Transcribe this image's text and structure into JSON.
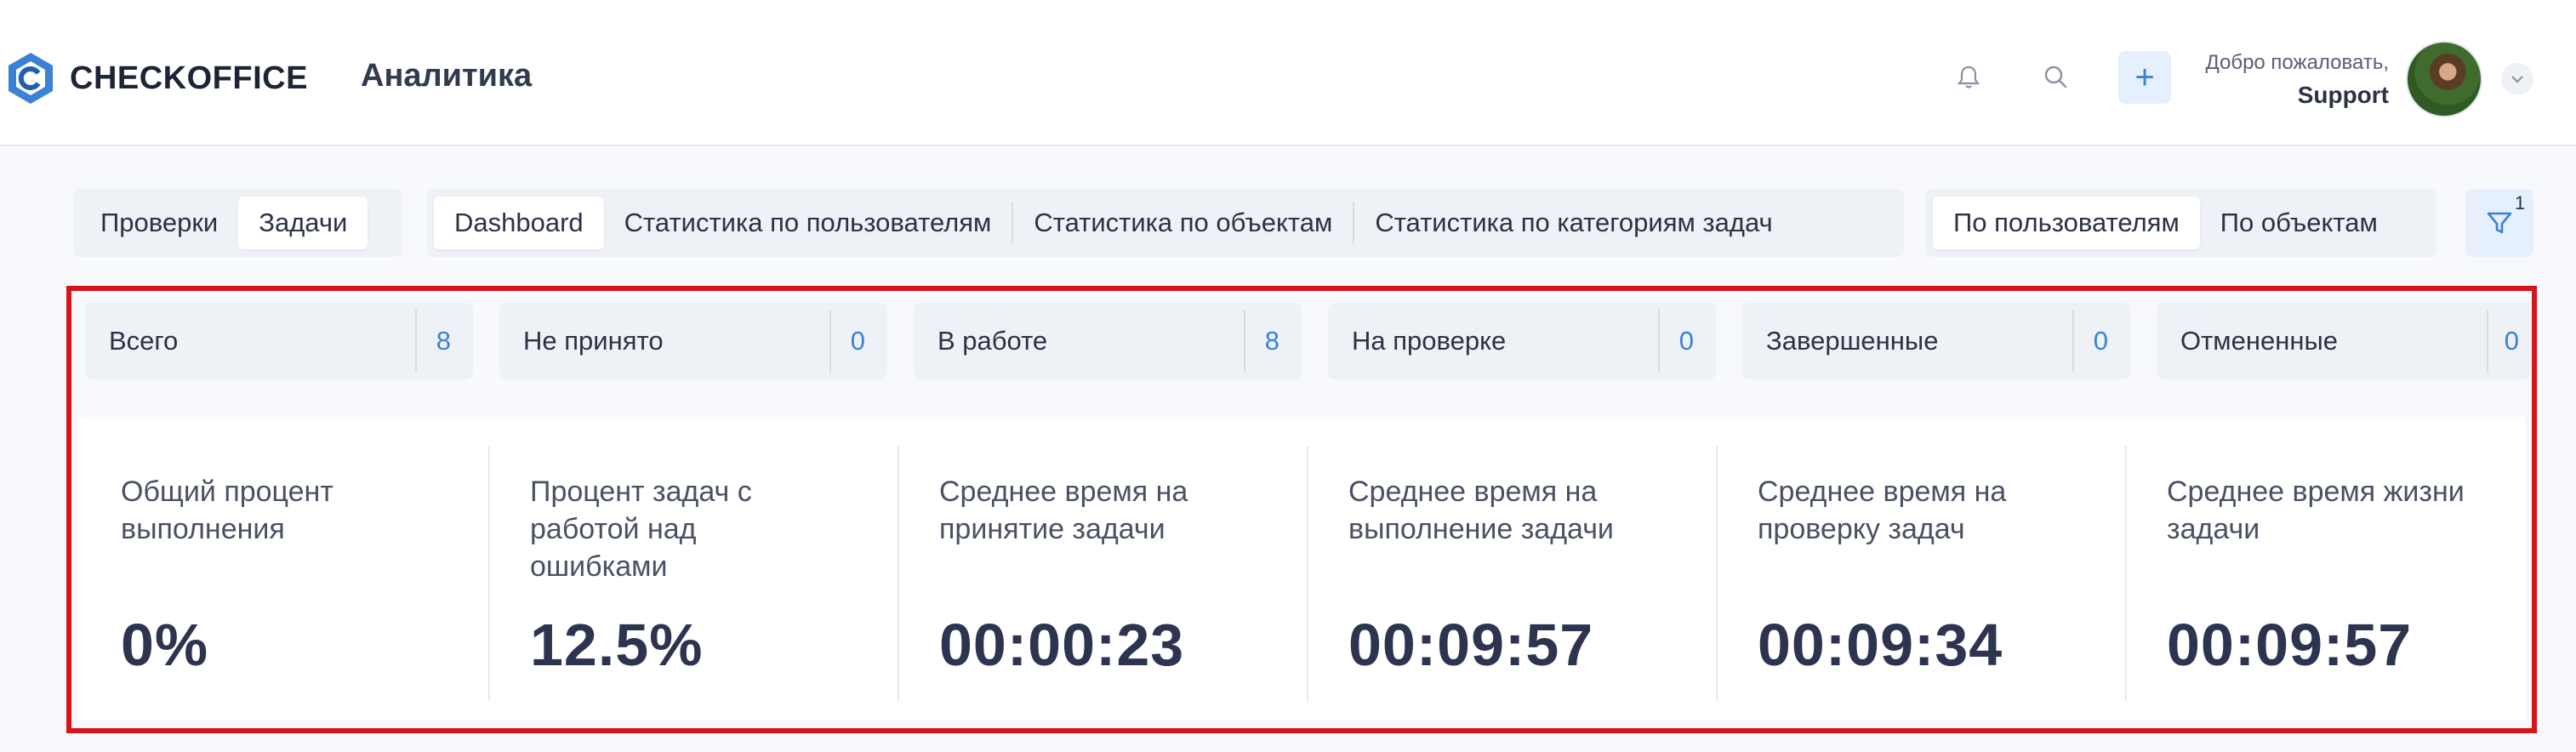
{
  "app": {
    "logo_text": "CHECKOFFICE",
    "page_title": "Аналитика",
    "brand_color": "#3b82d6"
  },
  "header": {
    "icons": [
      "bell-icon",
      "search-icon",
      "plus-icon",
      "chevron-down-icon"
    ],
    "add_label": "+",
    "welcome_label": "Добро пожаловать,",
    "user_name": "Support"
  },
  "tabs": {
    "mode": [
      {
        "label": "Проверки",
        "active": false
      },
      {
        "label": "Задачи",
        "active": true
      }
    ],
    "views": [
      {
        "label": "Dashboard",
        "active": true
      },
      {
        "label": "Статистика по пользователям",
        "active": false
      },
      {
        "label": "Статистика по объектам",
        "active": false
      },
      {
        "label": "Статистика по категориям задач",
        "active": false
      }
    ],
    "grouping": [
      {
        "label": "По пользователям",
        "active": true
      },
      {
        "label": "По объектам",
        "active": false
      }
    ],
    "filter_count": "1"
  },
  "status_counts": [
    {
      "label": "Всего",
      "count": "8"
    },
    {
      "label": "Не принято",
      "count": "0"
    },
    {
      "label": "В работе",
      "count": "8"
    },
    {
      "label": "На проверке",
      "count": "0"
    },
    {
      "label": "Завершенные",
      "count": "0"
    },
    {
      "label": "Отмененные",
      "count": "0"
    }
  ],
  "kpis": [
    {
      "label": "Общий процент выполнения",
      "value": "0%"
    },
    {
      "label": "Процент задач с работой над ошибками",
      "value": "12.5%"
    },
    {
      "label": "Среднее время на принятие задачи",
      "value": "00:00:23"
    },
    {
      "label": "Среднее время на выполнение задачи",
      "value": "00:09:57"
    },
    {
      "label": "Среднее время на проверку задач",
      "value": "00:09:34"
    },
    {
      "label": "Среднее время жизни задачи",
      "value": "00:09:57"
    }
  ],
  "highlight_color": "#d7141a"
}
